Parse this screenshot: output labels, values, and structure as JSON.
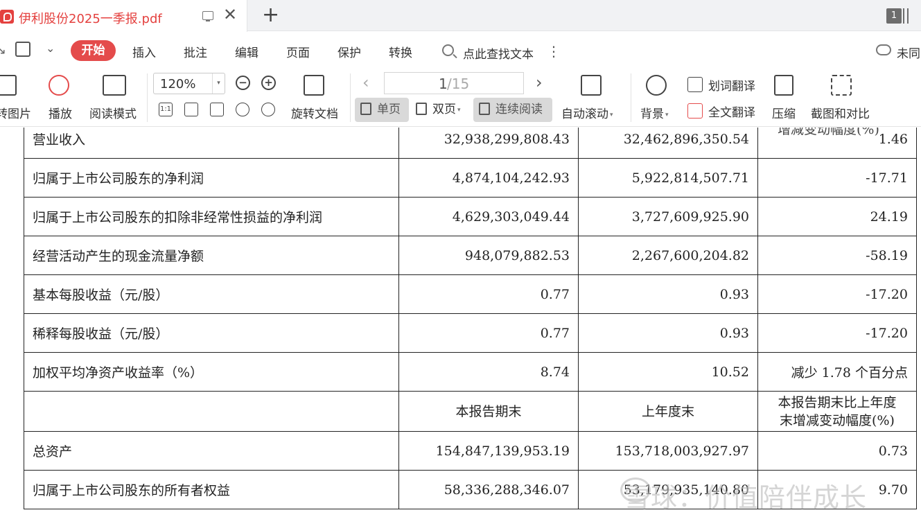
{
  "tab": {
    "title": "伊利股份2025一季报.pdf",
    "close": "✕",
    "new_tab": "+",
    "page_badge": "1"
  },
  "menu": {
    "items": [
      "开始",
      "插入",
      "批注",
      "编辑",
      "页面",
      "保护",
      "转换"
    ],
    "search_placeholder": "点此查找文本",
    "more": "⋮",
    "sync_status": "未同步"
  },
  "toolbar": {
    "convert_image": "转图片",
    "play": "播放",
    "read_mode": "阅读模式",
    "zoom": "120%",
    "rotate_doc": "旋转文档",
    "page_current": "1",
    "page_total": "/15",
    "single_page": "单页",
    "double_page": "双页",
    "continuous": "连续阅读",
    "auto_scroll": "自动滚动",
    "background": "背景",
    "word_translate": "划词翻译",
    "full_translate": "全文翻译",
    "compress": "压缩",
    "screenshot_compare": "截图和对比",
    "actual_size": "1:1"
  },
  "document": {
    "cut_header": "增减变动幅度(%)",
    "rows": [
      {
        "label": "营业收入",
        "current": "32,938,299,808.43",
        "previous": "32,462,896,350.54",
        "change": "1.46"
      },
      {
        "label": "归属于上市公司股东的净利润",
        "current": "4,874,104,242.93",
        "previous": "5,922,814,507.71",
        "change": "-17.71"
      },
      {
        "label": "归属于上市公司股东的扣除非经常性损益的净利润",
        "current": "4,629,303,049.44",
        "previous": "3,727,609,925.90",
        "change": "24.19"
      },
      {
        "label": "经营活动产生的现金流量净额",
        "current": "948,079,882.53",
        "previous": "2,267,600,204.82",
        "change": "-58.19"
      },
      {
        "label": "基本每股收益（元/股）",
        "current": "0.77",
        "previous": "0.93",
        "change": "-17.20"
      },
      {
        "label": "稀释每股收益（元/股）",
        "current": "0.77",
        "previous": "0.93",
        "change": "-17.20"
      },
      {
        "label": "加权平均净资产收益率（%）",
        "current": "8.74",
        "previous": "10.52",
        "change": "减少 1.78 个百分点"
      }
    ],
    "header2": {
      "label": "",
      "current": "本报告期末",
      "previous": "上年度末",
      "change_line1": "本报告期末比上年度",
      "change_line2": "末增减变动幅度(%)"
    },
    "rows2": [
      {
        "label": "总资产",
        "current": "154,847,139,953.19",
        "previous": "153,718,003,927.97",
        "change": "0.73"
      },
      {
        "label": "归属于上市公司股东的所有者权益",
        "current": "58,336,288,346.07",
        "previous": "53,179,935,140.80",
        "change": "9.70"
      }
    ]
  },
  "watermark": "雪球：价值陪伴成长"
}
